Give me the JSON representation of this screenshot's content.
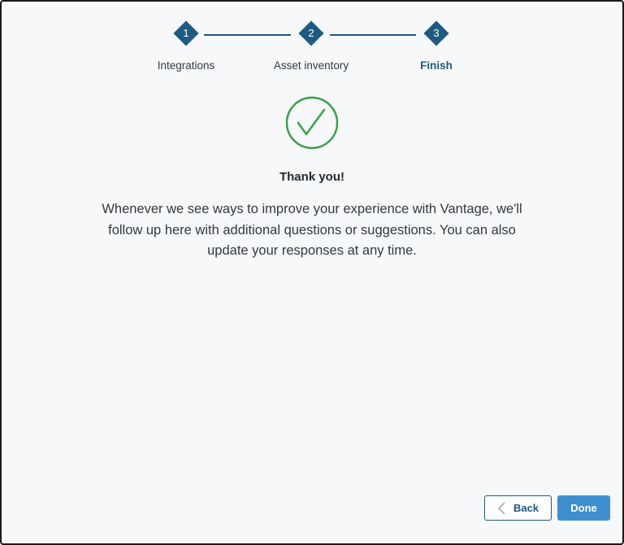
{
  "stepper": {
    "steps": [
      {
        "number": "1",
        "label": "Integrations"
      },
      {
        "number": "2",
        "label": "Asset inventory"
      },
      {
        "number": "3",
        "label": "Finish"
      }
    ],
    "active_step": "3"
  },
  "success_icon": "check-circle-icon",
  "content": {
    "title": "Thank you!",
    "message": "Whenever we see ways to improve your experience with Vantage, we'll follow up here with additional questions or suggestions. You can also update your responses at any time."
  },
  "buttons": {
    "back_label": "Back",
    "back_icon": "chevron-left-icon",
    "done_label": "Done"
  },
  "colors": {
    "primary": "#1f5a80",
    "success": "#3aa04a",
    "done_button": "#3f8fcf",
    "background": "#f6f8fa"
  }
}
